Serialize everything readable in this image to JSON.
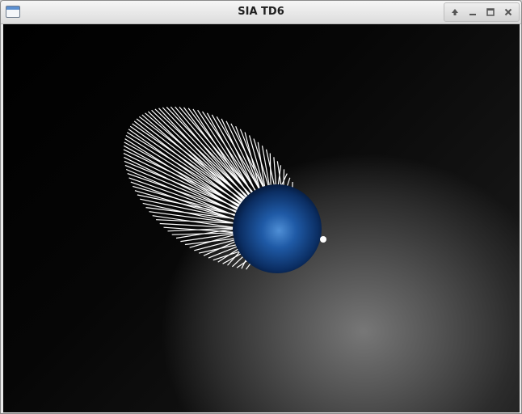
{
  "window": {
    "title": "SIA TD6",
    "app_icon": "window-app-icon",
    "controls": [
      {
        "name": "shade-button",
        "icon": "arrow-up-icon"
      },
      {
        "name": "minimize-button",
        "icon": "minimize-icon"
      },
      {
        "name": "maximize-button",
        "icon": "maximize-icon"
      },
      {
        "name": "close-button",
        "icon": "close-icon"
      }
    ]
  },
  "scene": {
    "background_color": "#000000",
    "light_glow_color": "#777777",
    "sphere_color": "#1f5aa6",
    "sphere_highlight": "#4f8fd6",
    "hair_color": "#ffffff",
    "light_marker_color": "#ffffff"
  }
}
